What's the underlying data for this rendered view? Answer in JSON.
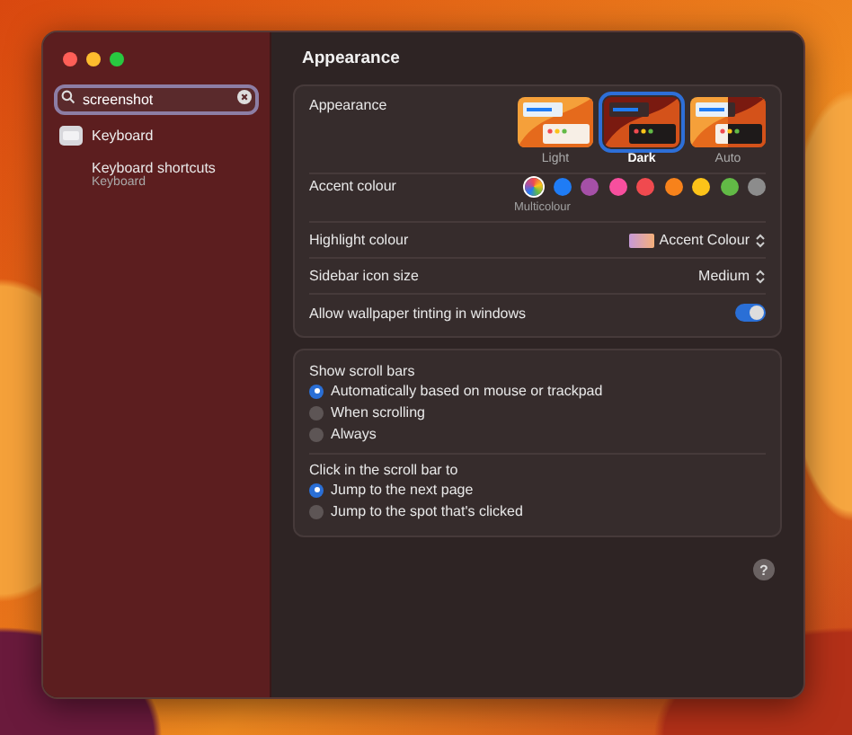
{
  "sidebar": {
    "search": {
      "value": "screenshot"
    },
    "results": [
      {
        "kind": "pane",
        "label": "Keyboard"
      },
      {
        "kind": "setting",
        "label": "Keyboard shortcuts",
        "subtitle": "Keyboard"
      }
    ]
  },
  "content": {
    "title": "Appearance",
    "appearance": {
      "label": "Appearance",
      "options": [
        {
          "kind": "light",
          "label": "Light",
          "selected": false
        },
        {
          "kind": "dark",
          "label": "Dark",
          "selected": true
        },
        {
          "kind": "auto",
          "label": "Auto",
          "selected": false
        }
      ]
    },
    "accent": {
      "label": "Accent colour",
      "caption": "Multicolour",
      "colors": [
        {
          "kind": "multicolour",
          "selected": true
        },
        {
          "kind": "solid",
          "color": "#1f7cf5",
          "selected": false
        },
        {
          "kind": "solid",
          "color": "#a550a7",
          "selected": false
        },
        {
          "kind": "solid",
          "color": "#f74f9e",
          "selected": false
        },
        {
          "kind": "solid",
          "color": "#f04a4f",
          "selected": false
        },
        {
          "kind": "solid",
          "color": "#f7821b",
          "selected": false
        },
        {
          "kind": "solid",
          "color": "#fcc319",
          "selected": false
        },
        {
          "kind": "solid",
          "color": "#62ba46",
          "selected": false
        },
        {
          "kind": "solid",
          "color": "#8c8c8c",
          "selected": false
        }
      ]
    },
    "highlight": {
      "label": "Highlight colour",
      "value": "Accent Colour"
    },
    "icon_size": {
      "label": "Sidebar icon size",
      "value": "Medium"
    },
    "tinting": {
      "label": "Allow wallpaper tinting in windows",
      "on": true
    },
    "scroll_bars": {
      "label": "Show scroll bars",
      "options": [
        {
          "label": "Automatically based on mouse or trackpad",
          "selected": true
        },
        {
          "label": "When scrolling",
          "selected": false
        },
        {
          "label": "Always",
          "selected": false
        }
      ]
    },
    "click_scroll": {
      "label": "Click in the scroll bar to",
      "options": [
        {
          "label": "Jump to the next page",
          "selected": true
        },
        {
          "label": "Jump to the spot that's clicked",
          "selected": false
        }
      ]
    },
    "help": {
      "label": "?"
    }
  }
}
